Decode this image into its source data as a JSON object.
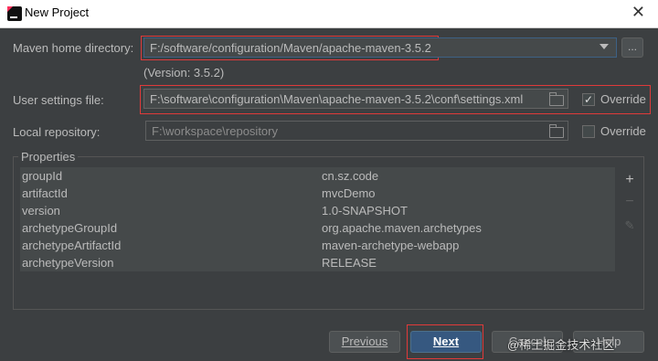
{
  "window": {
    "title": "New Project",
    "close_label": "✕"
  },
  "maven_home": {
    "label": "Maven home directory:",
    "value": "F:/software/configuration/Maven/apache-maven-3.5.2",
    "version": "(Version: 3.5.2)",
    "browse_label": "..."
  },
  "user_settings": {
    "label": "User settings file:",
    "value": "F:\\software\\configuration\\Maven\\apache-maven-3.5.2\\conf\\settings.xml",
    "override_label": "Override",
    "override_checked": true
  },
  "local_repo": {
    "label": "Local repository:",
    "value": "F:\\workspace\\repository",
    "override_label": "Override",
    "override_checked": false
  },
  "properties": {
    "title": "Properties",
    "rows": [
      {
        "key": "groupId",
        "value": "cn.sz.code"
      },
      {
        "key": "artifactId",
        "value": "mvcDemo"
      },
      {
        "key": "version",
        "value": "1.0-SNAPSHOT"
      },
      {
        "key": "archetypeGroupId",
        "value": "org.apache.maven.archetypes"
      },
      {
        "key": "archetypeArtifactId",
        "value": "maven-archetype-webapp"
      },
      {
        "key": "archetypeVersion",
        "value": "RELEASE"
      }
    ],
    "tools": {
      "add": "+",
      "remove": "−",
      "edit": "✎"
    }
  },
  "buttons": {
    "previous": "Previous",
    "next": "Next",
    "cancel": "Cancel",
    "help": "Help"
  },
  "watermark": "@稀土掘金技术社区",
  "colors": {
    "background": "#3c3f41",
    "highlight_box": "#e03a3a",
    "primary_button": "#365880"
  }
}
